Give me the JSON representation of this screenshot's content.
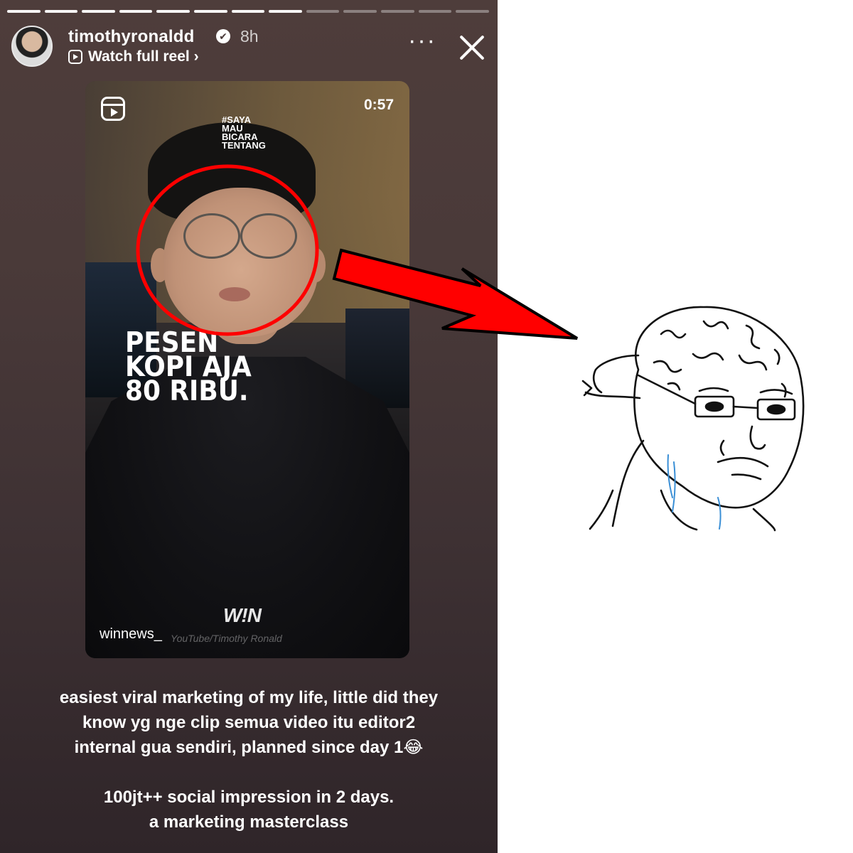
{
  "story": {
    "username": "timothyronaldd",
    "verified_mark": "✔",
    "time_ago": "8h",
    "watch_reel_label": "Watch full reel ›",
    "more_label": "···",
    "progress_segments_total": 13,
    "progress_segments_done": 8,
    "reel": {
      "duration": "0:57",
      "hashtag_lines": [
        "#SAYA",
        "MAU",
        "BICARA",
        "TENTANG"
      ],
      "headline_lines": [
        "PESEN",
        "KOPI AJA",
        "80 RIBU."
      ],
      "brand": "W!N",
      "handle": "winnews_",
      "watermark": "YouTube/Timothy Ronald"
    },
    "caption": {
      "paragraph1": [
        "easiest viral marketing of my life, little did they",
        "know yg nge clip semua video itu editor2",
        "internal gua sendiri, planned since day 1😂"
      ],
      "paragraph2": [
        "100jt++ social impression in 2 days.",
        "a marketing masterclass"
      ]
    }
  },
  "colors": {
    "story_bg": "#4a3a39",
    "annotation_red": "#ff0000"
  },
  "icons": {
    "reel": "reel-icon",
    "close": "close-icon",
    "more": "more-icon",
    "verified": "verified-badge-icon"
  }
}
